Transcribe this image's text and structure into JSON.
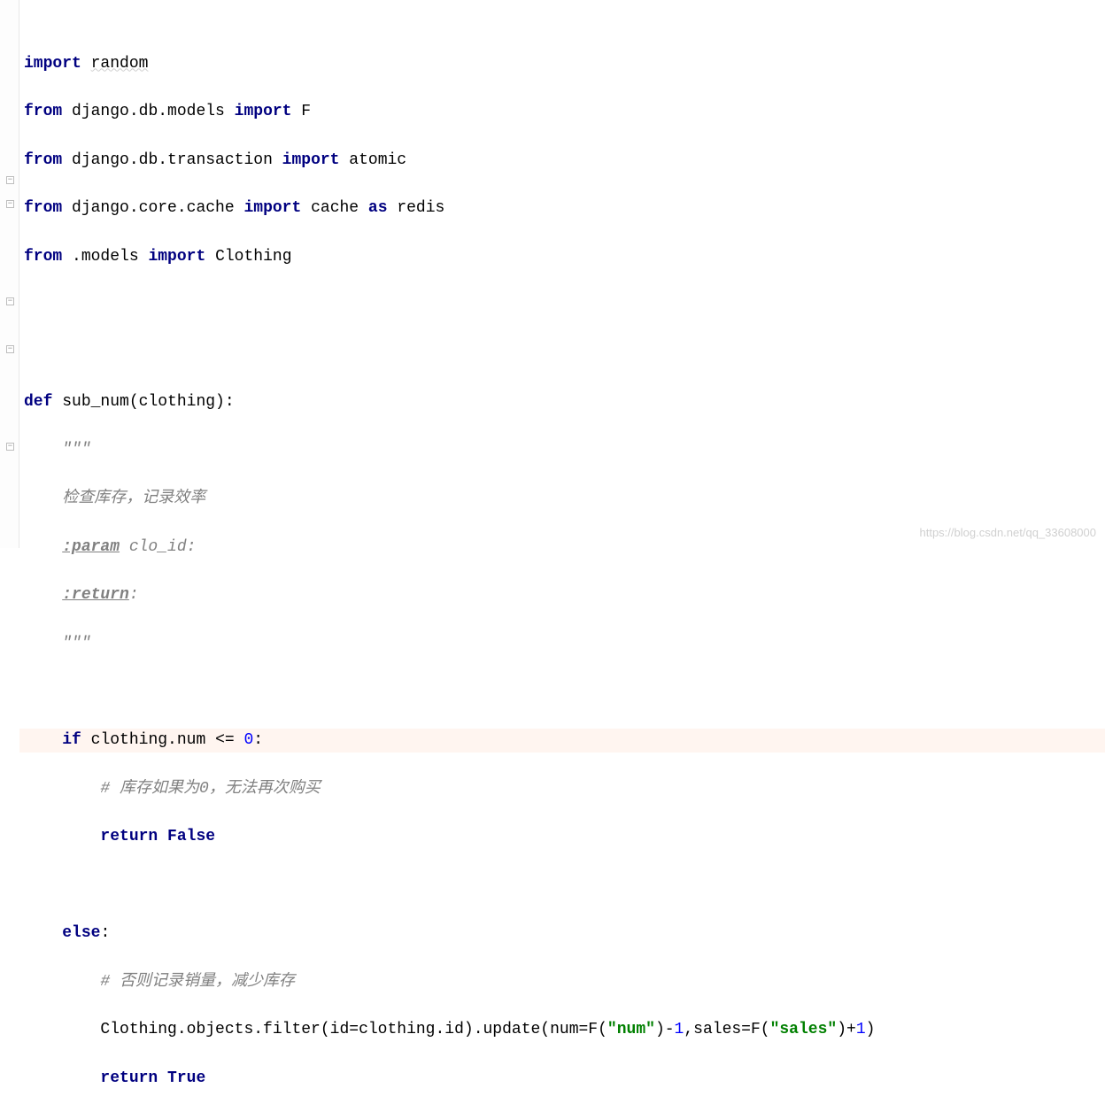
{
  "lines": {
    "l1": {
      "kw1": "import",
      "sp1": " ",
      "id1": "random"
    },
    "l2": {
      "kw1": "from",
      "sp1": " ",
      "id1": "django.db.models ",
      "kw2": "import",
      "sp2": " ",
      "id2": "F"
    },
    "l3": {
      "kw1": "from",
      "sp1": " ",
      "id1": "django.db.transaction ",
      "kw2": "import",
      "sp2": " ",
      "id2": "atomic"
    },
    "l4": {
      "kw1": "from",
      "sp1": " ",
      "id1": "django.core.cache ",
      "kw2": "import",
      "sp2": " ",
      "id2": "cache ",
      "kw3": "as",
      "sp3": " ",
      "id3": "redis"
    },
    "l5": {
      "kw1": "from",
      "sp1": " ",
      "id1": ".models ",
      "kw2": "import",
      "sp2": " ",
      "id2": "Clothing"
    },
    "l8": {
      "kw1": "def",
      "sp1": " ",
      "fn": "sub_num",
      "paren": "(clothing):"
    },
    "l9": {
      "ind": "    ",
      "doc": "\"\"\""
    },
    "l10": {
      "ind": "    ",
      "doc": "检查库存，记录效率"
    },
    "l11": {
      "ind": "    ",
      "docb": ":param",
      "doc": " clo_id:"
    },
    "l12": {
      "ind": "    ",
      "docb": ":return",
      "doc": ":"
    },
    "l13": {
      "ind": "    ",
      "doc": "\"\"\""
    },
    "l15": {
      "ind": "    ",
      "kw1": "if",
      "sp1": " ",
      "id1": "clothing.num <= ",
      "num": "0",
      "id2": ":"
    },
    "l16": {
      "ind": "        ",
      "cm": "# 库存如果为0，无法再次购买"
    },
    "l17": {
      "ind": "        ",
      "kw1": "return False"
    },
    "l19": {
      "ind": "    ",
      "kw1": "else",
      "id1": ":"
    },
    "l20": {
      "ind": "        ",
      "cm": "# 否则记录销量，减少库存"
    },
    "l21": {
      "ind": "        ",
      "id1": "Clothing.objects.filter(id=clothing.id).update(num=F(",
      "str1": "\"num\"",
      "id2": ")-",
      "num1": "1",
      "id3": ",sales=F(",
      "str2": "\"sales\"",
      "id4": ")+",
      "num2": "1",
      "id5": ")"
    },
    "l22": {
      "ind": "        ",
      "kw1": "return True"
    }
  },
  "watermark": "https://blog.csdn.net/qq_33608000"
}
